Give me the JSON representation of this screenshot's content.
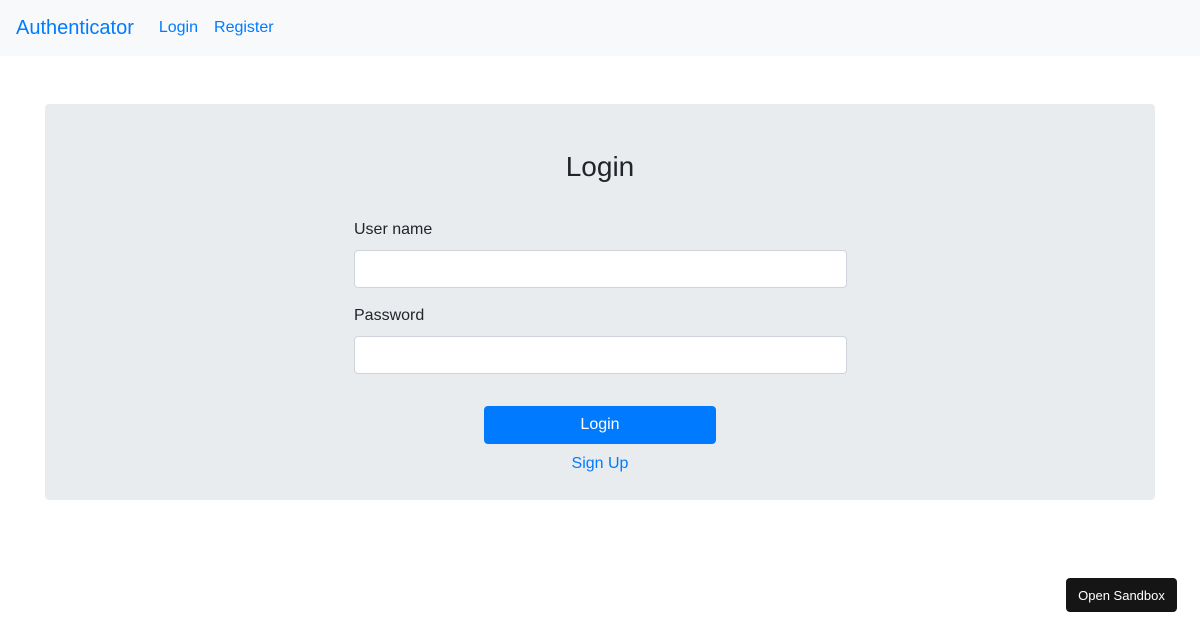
{
  "navbar": {
    "brand": "Authenticator",
    "links": [
      {
        "label": "Login"
      },
      {
        "label": "Register"
      }
    ]
  },
  "login_form": {
    "title": "Login",
    "username_label": "User name",
    "username_value": "",
    "password_label": "Password",
    "password_value": "",
    "submit_label": "Login",
    "signup_link": "Sign Up"
  },
  "sandbox_button": "Open Sandbox",
  "colors": {
    "accent": "#007bff",
    "navbar_bg": "#f8f9fa",
    "card_bg": "#e9ecef",
    "sandbox_bg": "#151515"
  }
}
